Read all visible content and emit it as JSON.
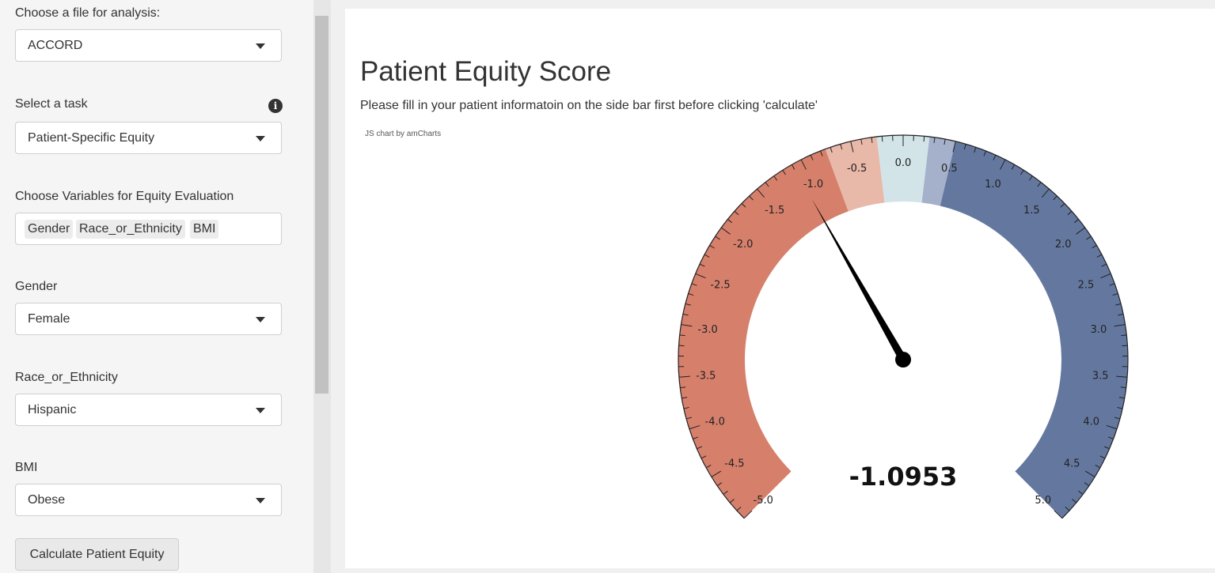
{
  "sidebar": {
    "file_label": "Choose a file for analysis:",
    "file_value": "ACCORD",
    "task_label": "Select a task",
    "task_value": "Patient-Specific Equity",
    "variables_label": "Choose Variables for Equity Evaluation",
    "variables": [
      "Gender",
      "Race_or_Ethnicity",
      "BMI"
    ],
    "gender_label": "Gender",
    "gender_value": "Female",
    "race_label": "Race_or_Ethnicity",
    "race_value": "Hispanic",
    "bmi_label": "BMI",
    "bmi_value": "Obese",
    "calculate_label": "Calculate Patient Equity",
    "info_icon": "info-icon",
    "caret_icon": "chevron-down-icon"
  },
  "main": {
    "title": "Patient Equity Score",
    "subtitle": "Please fill in your patient informatoin on the side bar first before clicking 'calculate'",
    "credit": "JS chart by amCharts"
  },
  "chart_data": {
    "type": "gauge",
    "min": -5,
    "max": 5,
    "value": -1.0953,
    "value_label": "-1.0953",
    "major_ticks": [
      "-5.0",
      "-4.5",
      "-4.0",
      "-3.5",
      "-3.0",
      "-2.5",
      "-2.0",
      "-1.5",
      "-1.0",
      "-0.5",
      "0.0",
      "0.5",
      "1.0",
      "1.5",
      "2.0",
      "2.5",
      "3.0",
      "3.5",
      "4.0",
      "4.5",
      "5.0"
    ],
    "bands": [
      {
        "from": -5,
        "to": -0.75,
        "color": "#d6806c"
      },
      {
        "from": -0.75,
        "to": -0.25,
        "color": "#e8b8a8"
      },
      {
        "from": -0.25,
        "to": 0.25,
        "color": "#d2e4e8"
      },
      {
        "from": 0.25,
        "to": 0.5,
        "color": "#a5b1ca"
      },
      {
        "from": 0.5,
        "to": 5,
        "color": "#64789f"
      }
    ]
  }
}
